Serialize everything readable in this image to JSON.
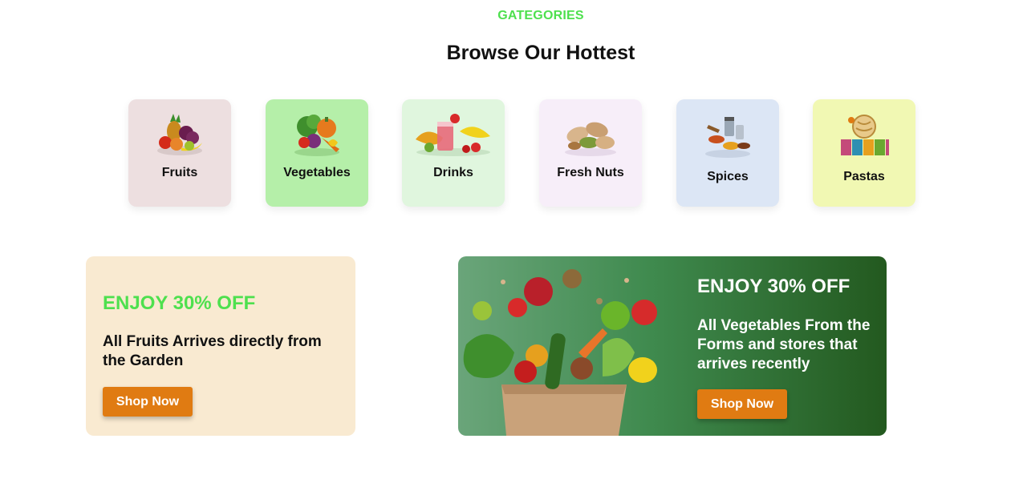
{
  "section": {
    "eyebrow": "GATEGORIES",
    "title": "Browse Our Hottest"
  },
  "categories": [
    {
      "label": "Fruits",
      "bg": "#eddfe0",
      "icon": "fruits-icon"
    },
    {
      "label": "Vegetables",
      "bg": "#b5efa9",
      "icon": "vegetables-icon"
    },
    {
      "label": "Drinks",
      "bg": "#e0f6de",
      "icon": "drinks-icon"
    },
    {
      "label": "Fresh Nuts",
      "bg": "#f7eef9",
      "icon": "nuts-icon"
    },
    {
      "label": "Spices",
      "bg": "#dce6f5",
      "icon": "spices-icon"
    },
    {
      "label": "Pastas",
      "bg": "#f1f8b3",
      "icon": "pastas-icon"
    }
  ],
  "promo_fruits": {
    "title": "ENJOY 30% OFF",
    "text": "All Fruits Arrives directly from the Garden",
    "button": "Shop Now",
    "accent": "#4ee04e",
    "bg": "#f9ead1"
  },
  "promo_vegetables": {
    "title": "ENJOY 30% OFF",
    "text": "All Vegetables From the Forms and stores that arrives recently",
    "button": "Shop Now",
    "image": "grocery-bag-illustration"
  },
  "colors": {
    "button": "#e07b12",
    "accent": "#4ee04e"
  }
}
